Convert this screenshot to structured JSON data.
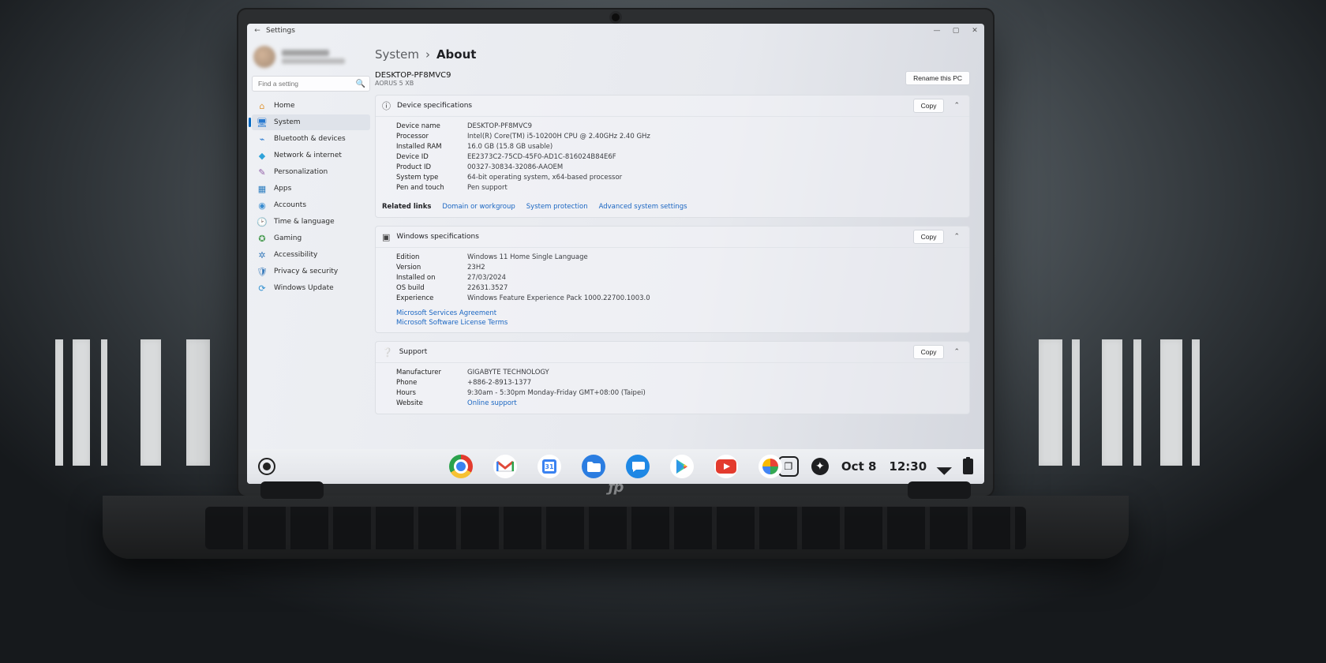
{
  "window": {
    "app_title": "Settings"
  },
  "sidebar": {
    "search_placeholder": "Find a setting",
    "items": [
      {
        "label": "Home"
      },
      {
        "label": "System"
      },
      {
        "label": "Bluetooth & devices"
      },
      {
        "label": "Network & internet"
      },
      {
        "label": "Personalization"
      },
      {
        "label": "Apps"
      },
      {
        "label": "Accounts"
      },
      {
        "label": "Time & language"
      },
      {
        "label": "Gaming"
      },
      {
        "label": "Accessibility"
      },
      {
        "label": "Privacy & security"
      },
      {
        "label": "Windows Update"
      }
    ]
  },
  "breadcrumb": {
    "root": "System",
    "leaf": "About"
  },
  "device_header": {
    "name": "DESKTOP-PF8MVC9",
    "model": "AORUS 5 XB",
    "rename_btn": "Rename this PC"
  },
  "cards": {
    "device": {
      "title": "Device specifications",
      "copy": "Copy",
      "rows": [
        {
          "k": "Device name",
          "v": "DESKTOP-PF8MVC9"
        },
        {
          "k": "Processor",
          "v": "Intel(R) Core(TM) i5-10200H CPU @ 2.40GHz   2.40 GHz"
        },
        {
          "k": "Installed RAM",
          "v": "16.0 GB (15.8 GB usable)"
        },
        {
          "k": "Device ID",
          "v": "EE2373C2-75CD-45F0-AD1C-816024B84E6F"
        },
        {
          "k": "Product ID",
          "v": "00327-30834-32086-AAOEM"
        },
        {
          "k": "System type",
          "v": "64-bit operating system, x64-based processor"
        },
        {
          "k": "Pen and touch",
          "v": "Pen support"
        }
      ],
      "related_label": "Related links",
      "related": [
        "Domain or workgroup",
        "System protection",
        "Advanced system settings"
      ]
    },
    "windows": {
      "title": "Windows specifications",
      "copy": "Copy",
      "rows": [
        {
          "k": "Edition",
          "v": "Windows 11 Home Single Language"
        },
        {
          "k": "Version",
          "v": "23H2"
        },
        {
          "k": "Installed on",
          "v": "27/03/2024"
        },
        {
          "k": "OS build",
          "v": "22631.3527"
        },
        {
          "k": "Experience",
          "v": "Windows Feature Experience Pack 1000.22700.1003.0"
        }
      ],
      "links": [
        "Microsoft Services Agreement",
        "Microsoft Software License Terms"
      ]
    },
    "support": {
      "title": "Support",
      "copy": "Copy",
      "rows": [
        {
          "k": "Manufacturer",
          "v": "GIGABYTE TECHNOLOGY"
        },
        {
          "k": "Phone",
          "v": "+886-2-8913-1377"
        },
        {
          "k": "Hours",
          "v": "9:30am - 5:30pm Monday-Friday GMT+08:00 (Taipei)"
        }
      ],
      "website_k": "Website",
      "website_v": "Online support"
    }
  },
  "shelf": {
    "date": "Oct 8",
    "time": "12:30"
  }
}
